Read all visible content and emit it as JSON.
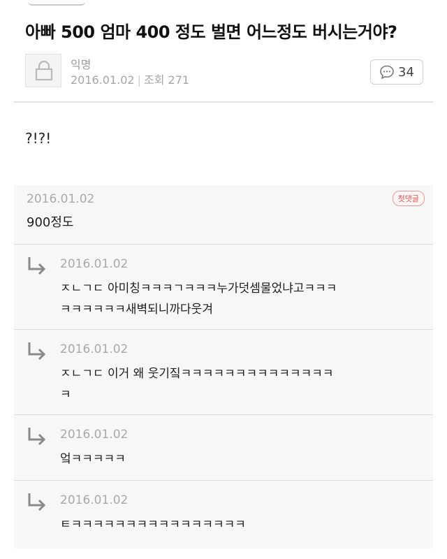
{
  "post": {
    "title": "아빠 500 엄마 400 정도 벌면 어느정도 버시는거야?",
    "author": "익명",
    "date": "2016.01.02",
    "views_label": "조회 271",
    "comment_count": "34",
    "body": "?!?!"
  },
  "comments": {
    "first": {
      "date": "2016.01.02",
      "badge": "첫댓글",
      "text": "900정도"
    },
    "replies": [
      {
        "date": "2016.01.02",
        "lines": [
          "ㅈㄴㄱㄷ 아미칭ㅋㅋㅋㄱㅋㅋㅋ누가덧셈물었냐고ㅋㅋㅋ",
          "ㅋㅋㅋㅋㅋㅋ새벽되니까다웃겨"
        ]
      },
      {
        "date": "2016.01.02",
        "lines": [
          "ㅈㄴㄱㄷ 이거 왜 웃기짘ㅋㅋㅋㅋㅋㅋㅋㅋㅋㅋㅋㅋㅋㅋ",
          "ㅋ"
        ]
      },
      {
        "date": "2016.01.02",
        "lines": [
          "엌ㅋㅋㅋㅋㅋ"
        ]
      },
      {
        "date": "2016.01.02",
        "lines": [
          "ㅌㅋㅋㅋㅋㅋㅋㅋㅋㅋㅋㅋㅋㅋㅋㅋㅋ"
        ]
      }
    ]
  },
  "icons": {
    "avatar": "lock-icon",
    "comment": "speech-bubble-icon",
    "reply": "reply-arrow-icon"
  },
  "colors": {
    "badge": "#d9534f",
    "comment_background": "#f7f7f7",
    "muted_text": "#a9a9a9"
  }
}
